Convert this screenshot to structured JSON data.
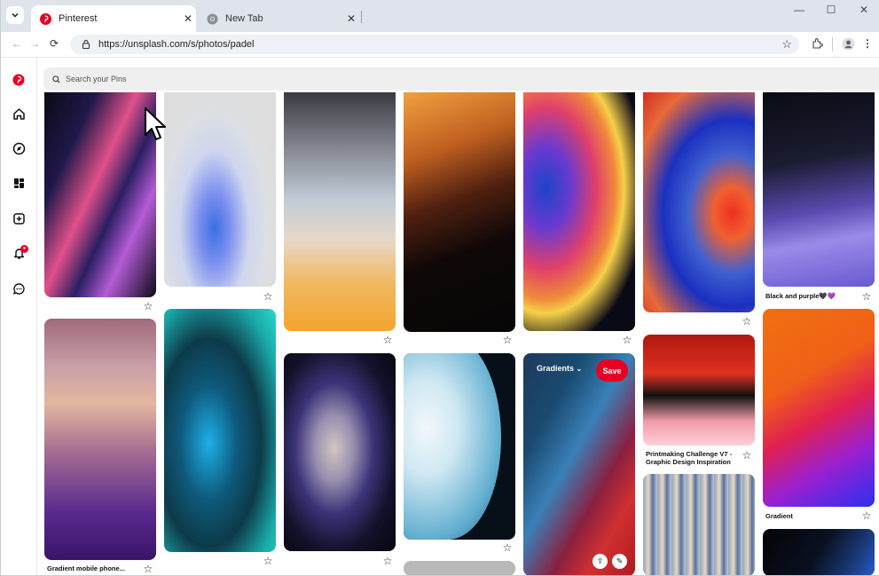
{
  "browser": {
    "tabs": [
      {
        "title": "Pinterest",
        "icon": "pinterest-icon",
        "active": true
      },
      {
        "title": "New Tab",
        "icon": "chrome-icon",
        "active": false
      }
    ],
    "url": "https://unsplash.com/s/photos/padel"
  },
  "sidebar": {
    "items": [
      {
        "name": "pinterest-logo-icon"
      },
      {
        "name": "home-icon"
      },
      {
        "name": "explore-icon"
      },
      {
        "name": "boards-icon"
      },
      {
        "name": "create-icon"
      },
      {
        "name": "notifications-icon"
      },
      {
        "name": "messages-icon"
      }
    ]
  },
  "search": {
    "placeholder": "Search your Pins"
  },
  "pins": {
    "captions": {
      "c1": "Gradient mobile phone...",
      "c7a": "Black and purple🖤💜",
      "c6b": "Printmaking Challenge V7 -",
      "c6b2": "Graphic Design Inspiration",
      "c7b": "Gradient"
    },
    "hover": {
      "board": "Gradients",
      "save": "Save"
    }
  },
  "colors": {
    "brand": "#e60023"
  }
}
